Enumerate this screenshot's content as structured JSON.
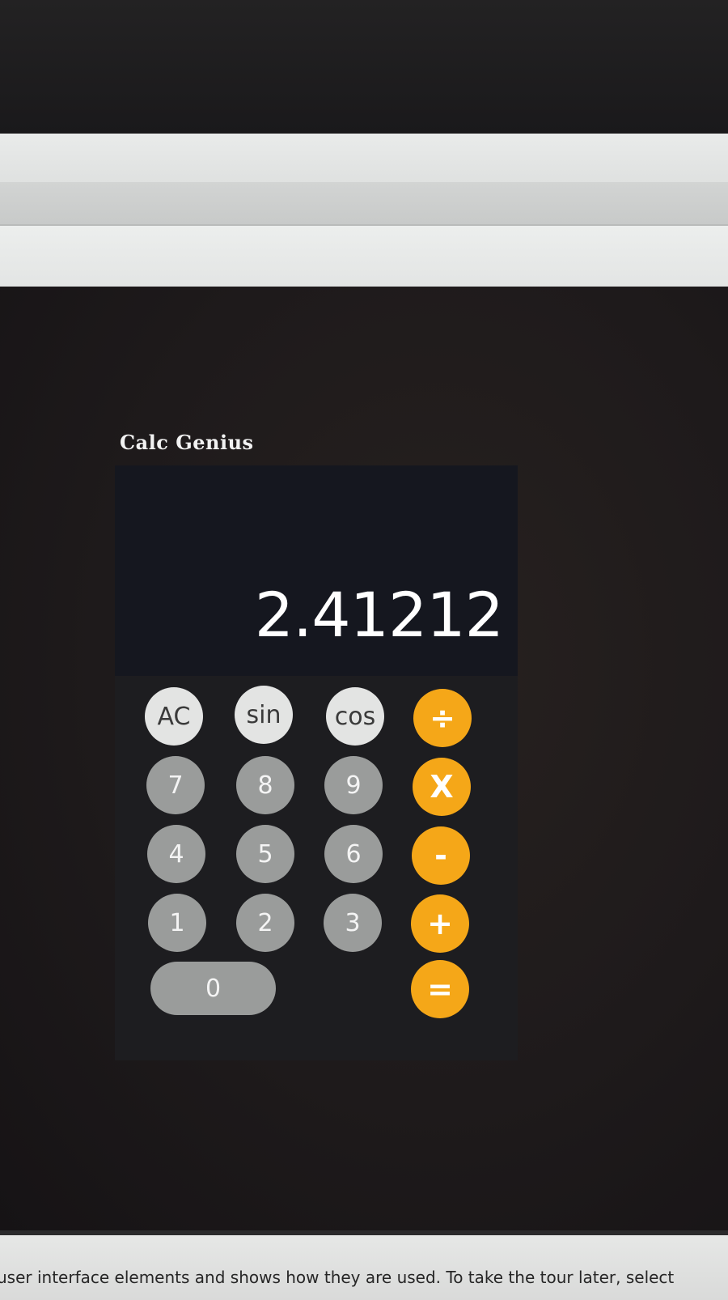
{
  "app": {
    "title": "Calc Genius"
  },
  "display": {
    "value": "2.41212"
  },
  "keys": {
    "ac": "AC",
    "sin": "sin",
    "cos": "cos",
    "divide": "÷",
    "seven": "7",
    "eight": "8",
    "nine": "9",
    "multiply": "X",
    "four": "4",
    "five": "5",
    "six": "6",
    "minus": "-",
    "one": "1",
    "two": "2",
    "three": "3",
    "plus": "+",
    "zero": "0",
    "equals": "="
  },
  "footer": {
    "text": "user interface elements and shows how they are used. To take the tour later, select"
  },
  "colors": {
    "operator": "#f5a718",
    "number_key": "#9a9c9b",
    "function_key": "#e3e4e3",
    "calculator_bg": "#151519"
  }
}
